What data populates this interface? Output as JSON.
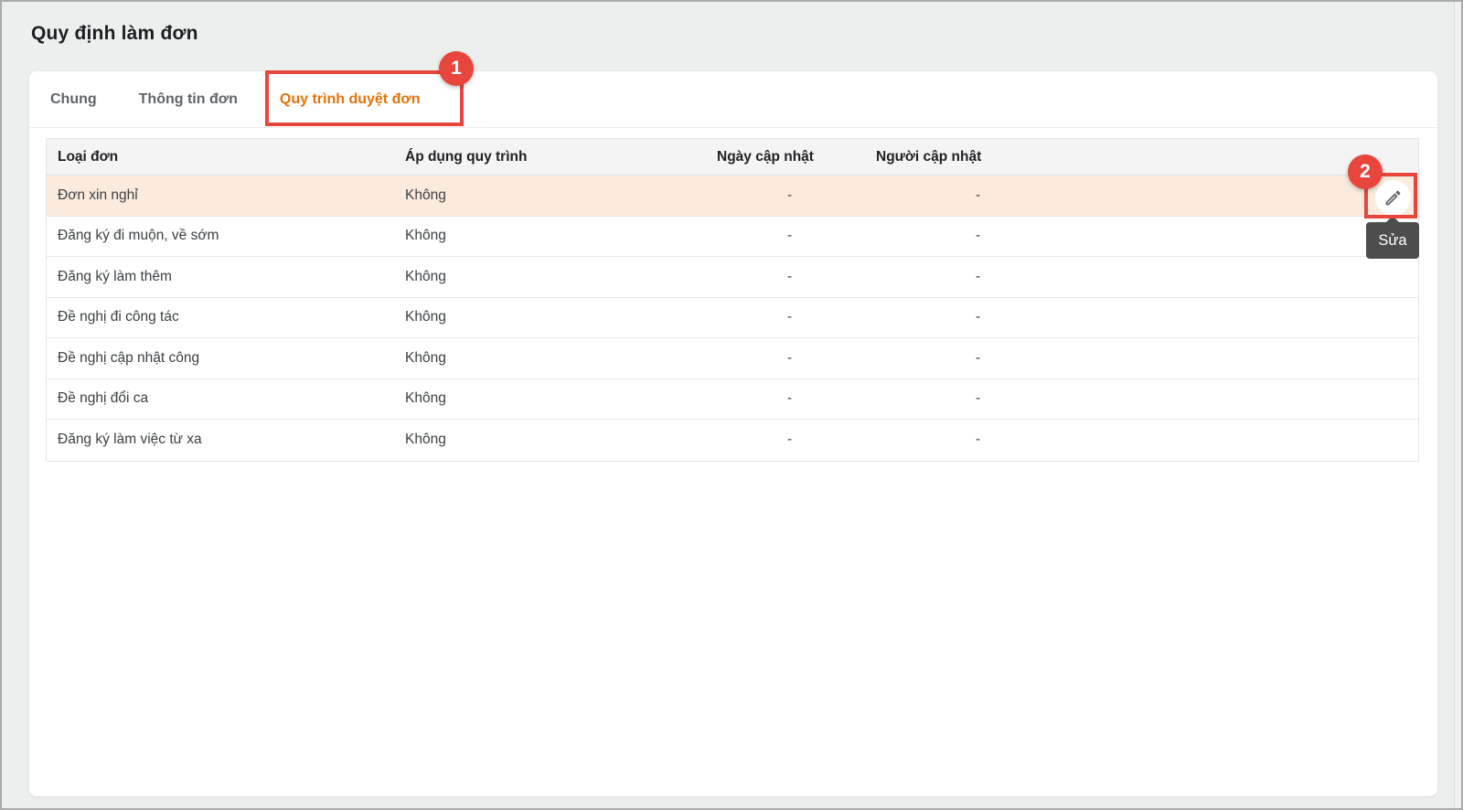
{
  "header": {
    "title": "Quy định làm đơn"
  },
  "tabs": [
    {
      "label": "Chung",
      "active": false
    },
    {
      "label": "Thông tin đơn",
      "active": false
    },
    {
      "label": "Quy trình duyệt đơn",
      "active": true
    }
  ],
  "table": {
    "columns": [
      "Loại đơn",
      "Áp dụng quy trình",
      "Ngày cập nhật",
      "Người cập nhật"
    ],
    "rows": [
      {
        "type": "Đơn xin nghỉ",
        "apply": "Không",
        "updated_date": "-",
        "updated_by": "-",
        "highlighted": true
      },
      {
        "type": "Đăng ký đi muộn, về sớm",
        "apply": "Không",
        "updated_date": "-",
        "updated_by": "-",
        "highlighted": false
      },
      {
        "type": "Đăng ký làm thêm",
        "apply": "Không",
        "updated_date": "-",
        "updated_by": "-",
        "highlighted": false
      },
      {
        "type": "Đề nghị đi công tác",
        "apply": "Không",
        "updated_date": "-",
        "updated_by": "-",
        "highlighted": false
      },
      {
        "type": "Đề nghị cập nhật công",
        "apply": "Không",
        "updated_date": "-",
        "updated_by": "-",
        "highlighted": false
      },
      {
        "type": "Đề nghị đổi ca",
        "apply": "Không",
        "updated_date": "-",
        "updated_by": "-",
        "highlighted": false
      },
      {
        "type": "Đăng ký làm việc từ xa",
        "apply": "Không",
        "updated_date": "-",
        "updated_by": "-",
        "highlighted": false
      }
    ]
  },
  "action": {
    "edit_tooltip": "Sửa",
    "edit_icon": "pencil-icon"
  },
  "annotations": {
    "step1": "1",
    "step2": "2"
  },
  "colors": {
    "accent_orange": "#e8710a",
    "annotation_red": "#e8463c",
    "highlight_row": "#fcebdd",
    "tooltip_bg": "#4d4d4d",
    "header_row_bg": "#f4f4f4",
    "page_bg": "#edeeee"
  }
}
